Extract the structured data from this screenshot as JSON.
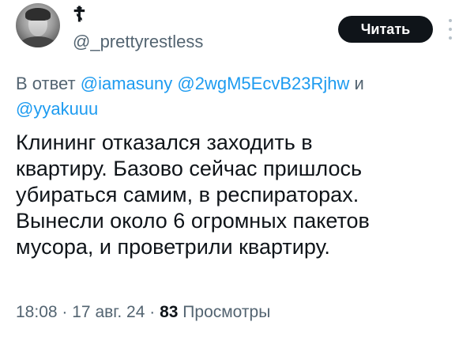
{
  "author": {
    "display_name": "☦",
    "handle": "@_prettyrestless"
  },
  "actions": {
    "follow_label": "Читать",
    "more_icon": "more-vertical-icon"
  },
  "reply": {
    "prefix": "В ответ",
    "mention_1": "@iamasuny",
    "mention_2": "@2wgM5EcvB23Rjhw",
    "conjunction": "и",
    "mention_3": "@yyakuuu"
  },
  "tweet": {
    "lines": [
      "Клининг отказался заходить в",
      "квартиру. Базово сейчас пришлось",
      "убираться самим, в респираторах.",
      "Вынесли около 6 огромных пакетов",
      "мусора, и проветрили квартиру."
    ]
  },
  "meta": {
    "time": "18:08",
    "separator": "·",
    "date": "17 авг. 24",
    "views_count": "83",
    "views_label": "Просмотры"
  },
  "colors": {
    "text": "#0f1419",
    "secondary": "#536471",
    "link": "#1d9bf0",
    "button_bg": "#0f1419"
  }
}
